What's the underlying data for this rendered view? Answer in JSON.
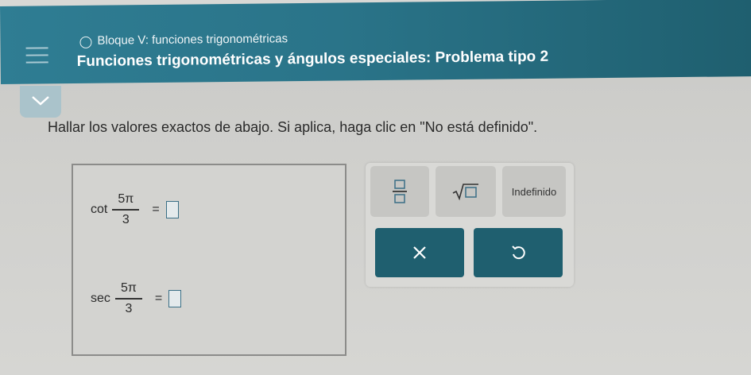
{
  "header": {
    "subtitle": "Bloque V: funciones trigonométricas",
    "title": "Funciones trigonométricas y ángulos especiales: Problema tipo 2"
  },
  "instruction": "Hallar los valores exactos de abajo. Si aplica, haga clic en \"No está definido\".",
  "questions": [
    {
      "fn": "cot",
      "numerator": "5π",
      "denominator": "3",
      "equals": "="
    },
    {
      "fn": "sec",
      "numerator": "5π",
      "denominator": "3",
      "equals": "="
    }
  ],
  "keypad": {
    "undefined_label": "Indefinido"
  },
  "icons": [
    "menu-icon",
    "circle-icon",
    "chevron-down-icon",
    "fraction-icon",
    "sqrt-icon",
    "clear-icon",
    "undo-icon"
  ],
  "colors": {
    "header": "#2a7489",
    "action": "#1f5f6f",
    "answer_border": "#3a6f86"
  }
}
